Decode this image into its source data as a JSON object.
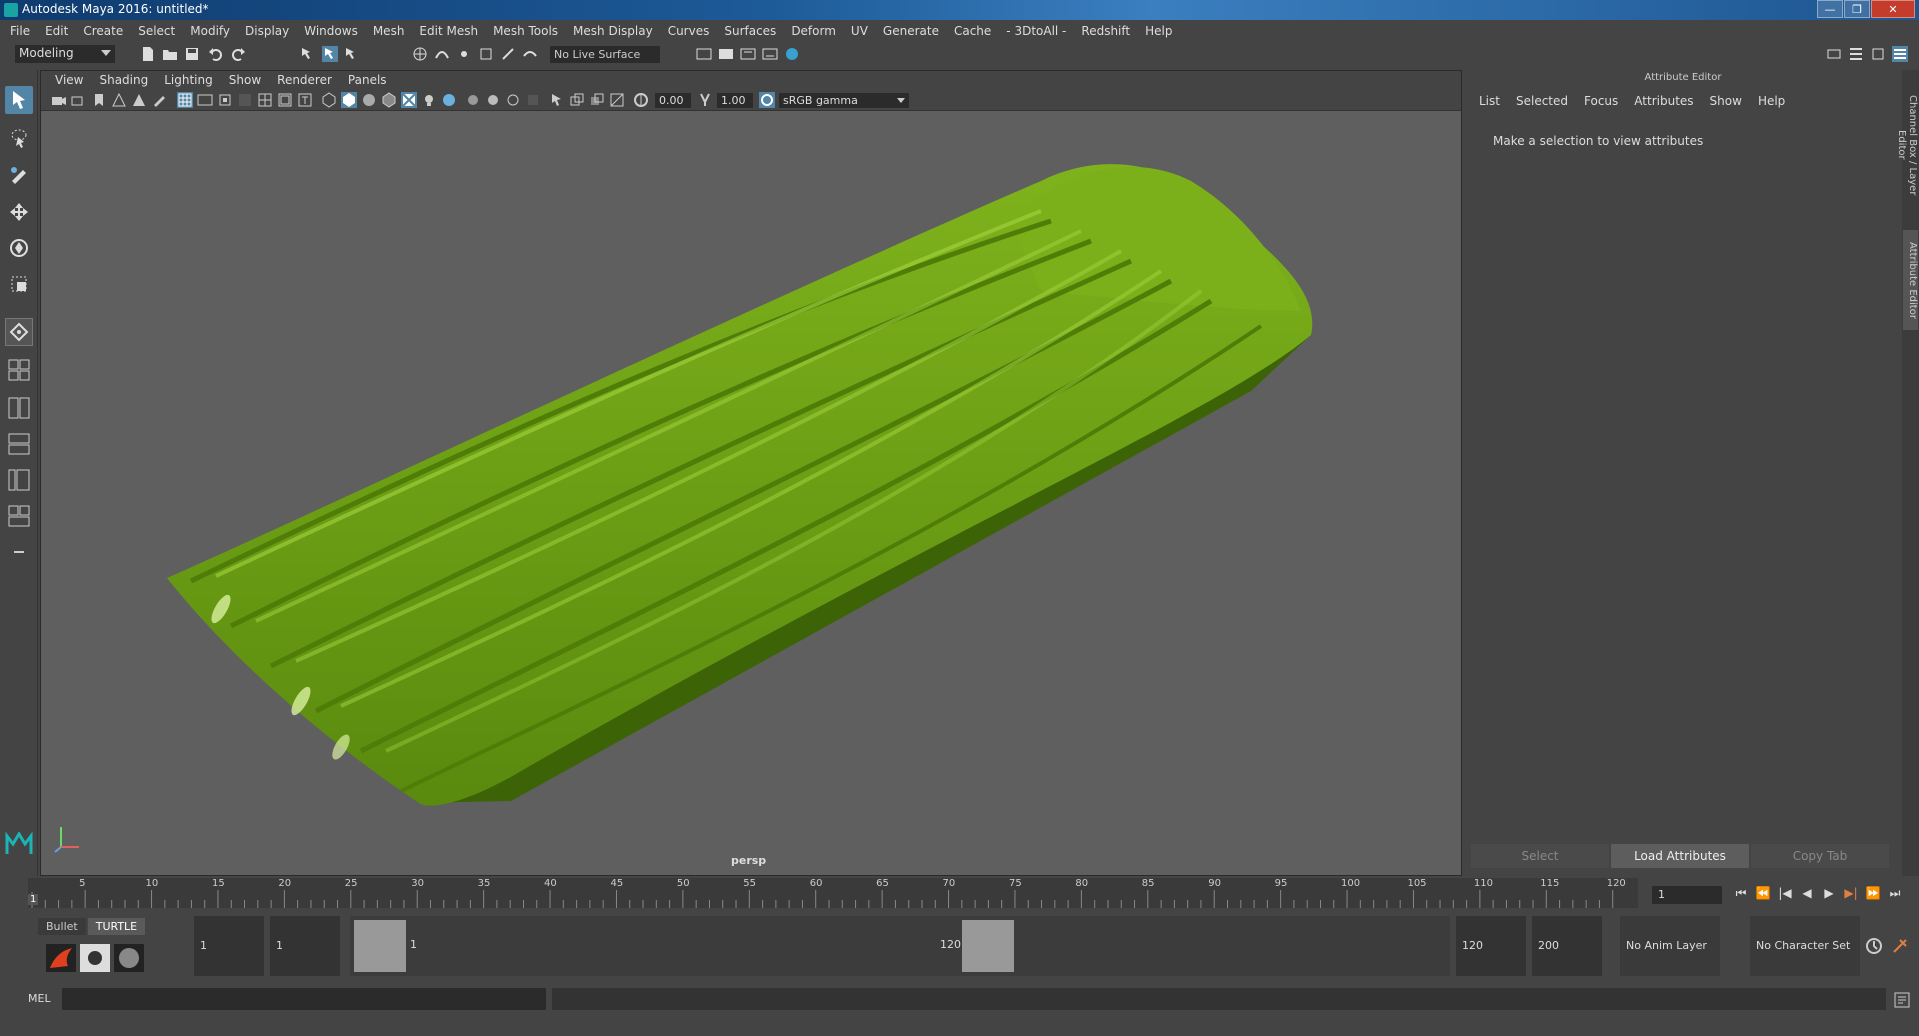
{
  "window": {
    "title": "Autodesk Maya 2016: untitled*",
    "controls": [
      "—",
      "❒",
      "✕"
    ]
  },
  "menubar": [
    "File",
    "Edit",
    "Create",
    "Select",
    "Modify",
    "Display",
    "Windows",
    "Mesh",
    "Edit Mesh",
    "Mesh Tools",
    "Mesh Display",
    "Curves",
    "Surfaces",
    "Deform",
    "UV",
    "Generate",
    "Cache",
    "- 3DtoAll -",
    "Redshift",
    "Help"
  ],
  "toolbar": {
    "mode": "Modeling",
    "live_surface": "No Live Surface"
  },
  "viewport": {
    "menu": [
      "View",
      "Shading",
      "Lighting",
      "Show",
      "Renderer",
      "Panels"
    ],
    "exposure": "0.00",
    "gamma": "1.00",
    "color_space": "sRGB gamma",
    "camera_label": "persp",
    "object_color": "#6a9a12"
  },
  "attribute_editor": {
    "title": "Attribute Editor",
    "menu": [
      "List",
      "Selected",
      "Focus",
      "Attributes",
      "Show",
      "Help"
    ],
    "message": "Make a selection to view attributes",
    "buttons": {
      "select": "Select",
      "load": "Load Attributes",
      "copy": "Copy Tab"
    }
  },
  "side_tabs": {
    "channel_box": "Channel Box / Layer Editor",
    "attribute_editor": "Attribute Editor"
  },
  "timeline": {
    "ticks": [
      "5",
      "10",
      "15",
      "20",
      "25",
      "30",
      "35",
      "40",
      "45",
      "50",
      "55",
      "60",
      "65",
      "70",
      "75",
      "80",
      "85",
      "90",
      "95",
      "100",
      "105",
      "110",
      "115",
      "120"
    ],
    "start_label": "1",
    "current_frame": "1",
    "playback_controls": [
      "⏮",
      "⏪",
      "|◀",
      "◀",
      "▶",
      "▶|",
      "⏩",
      "⏭"
    ]
  },
  "range": {
    "shelf_tabs": [
      "Bullet",
      "TURTLE"
    ],
    "start_time": "1",
    "playback_start": "1",
    "slider_start": "1",
    "slider_end": "120",
    "playback_end": "120",
    "end_time": "200",
    "anim_layer": "No Anim Layer",
    "character_set": "No Character Set"
  },
  "command_line": {
    "label": "MEL"
  }
}
